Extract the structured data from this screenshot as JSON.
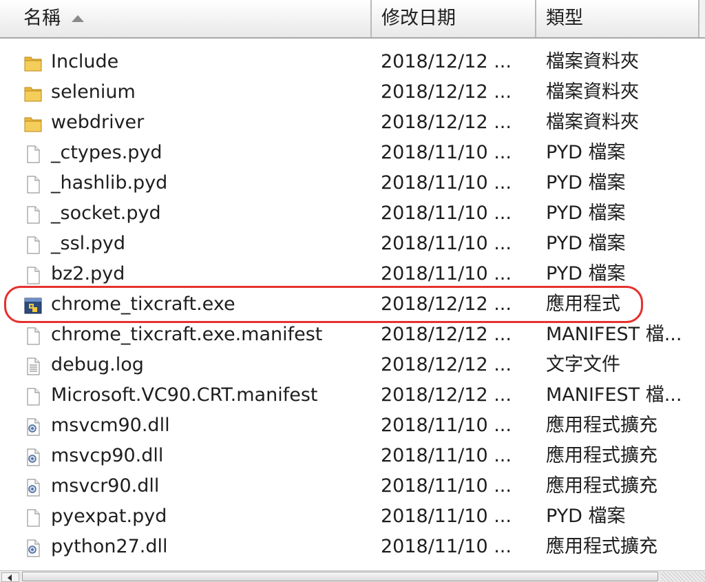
{
  "header": {
    "col_name": "名稱",
    "col_date": "修改日期",
    "col_type": "類型",
    "sort_icon": "sort-ascending-icon"
  },
  "colors": {
    "highlight": "#e5312f",
    "folder": "#e8b838"
  },
  "files": [
    {
      "name": "Include",
      "date": "2018/12/12 ...",
      "type": "檔案資料夾",
      "icon": "folder"
    },
    {
      "name": "selenium",
      "date": "2018/12/12 ...",
      "type": "檔案資料夾",
      "icon": "folder"
    },
    {
      "name": "webdriver",
      "date": "2018/12/12 ...",
      "type": "檔案資料夾",
      "icon": "folder"
    },
    {
      "name": "_ctypes.pyd",
      "date": "2018/11/10 ...",
      "type": "PYD 檔案",
      "icon": "file"
    },
    {
      "name": "_hashlib.pyd",
      "date": "2018/11/10 ...",
      "type": "PYD 檔案",
      "icon": "file"
    },
    {
      "name": "_socket.pyd",
      "date": "2018/11/10 ...",
      "type": "PYD 檔案",
      "icon": "file"
    },
    {
      "name": "_ssl.pyd",
      "date": "2018/11/10 ...",
      "type": "PYD 檔案",
      "icon": "file"
    },
    {
      "name": "bz2.pyd",
      "date": "2018/11/10 ...",
      "type": "PYD 檔案",
      "icon": "file"
    },
    {
      "name": "chrome_tixcraft.exe",
      "date": "2018/12/12 ...",
      "type": "應用程式",
      "icon": "exe"
    },
    {
      "name": "chrome_tixcraft.exe.manifest",
      "date": "2018/12/12 ...",
      "type": "MANIFEST 檔...",
      "icon": "file"
    },
    {
      "name": "debug.log",
      "date": "2018/12/12 ...",
      "type": "文字文件",
      "icon": "text"
    },
    {
      "name": "Microsoft.VC90.CRT.manifest",
      "date": "2018/12/12 ...",
      "type": "MANIFEST 檔...",
      "icon": "file"
    },
    {
      "name": "msvcm90.dll",
      "date": "2018/11/10 ...",
      "type": "應用程式擴充",
      "icon": "dll"
    },
    {
      "name": "msvcp90.dll",
      "date": "2018/11/10 ...",
      "type": "應用程式擴充",
      "icon": "dll"
    },
    {
      "name": "msvcr90.dll",
      "date": "2018/11/10 ...",
      "type": "應用程式擴充",
      "icon": "dll"
    },
    {
      "name": "pyexpat.pyd",
      "date": "2018/11/10 ...",
      "type": "PYD 檔案",
      "icon": "file"
    },
    {
      "name": "python27.dll",
      "date": "2018/11/10 ...",
      "type": "應用程式擴充",
      "icon": "dll"
    }
  ]
}
